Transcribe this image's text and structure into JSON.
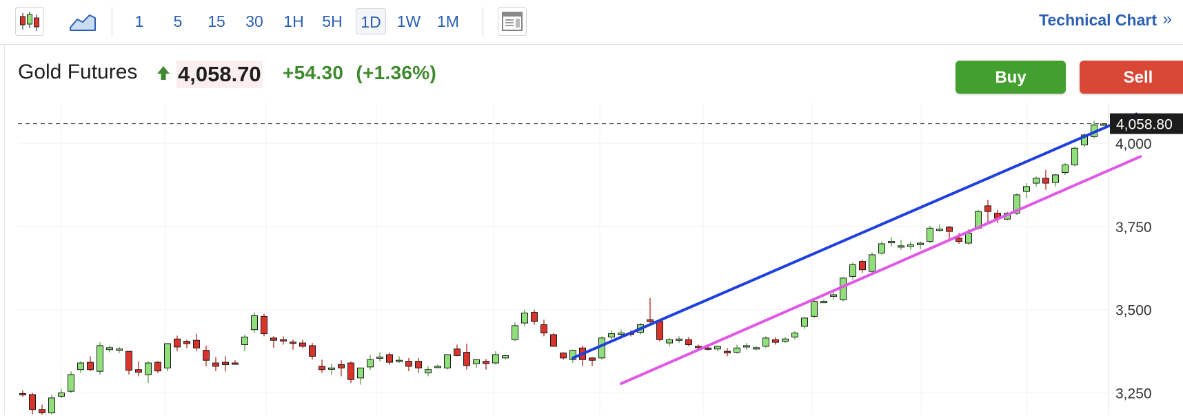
{
  "toolbar": {
    "chart_type_icon": "candlestick-icon",
    "area_icon": "area-chart-icon",
    "layout_icon": "layout-icon",
    "timeframes": [
      {
        "label": "1",
        "active": false
      },
      {
        "label": "5",
        "active": false
      },
      {
        "label": "15",
        "active": false
      },
      {
        "label": "30",
        "active": false
      },
      {
        "label": "1H",
        "active": false
      },
      {
        "label": "5H",
        "active": false
      },
      {
        "label": "1D",
        "active": true
      },
      {
        "label": "1W",
        "active": false
      },
      {
        "label": "1M",
        "active": false
      }
    ],
    "technical_chart_label": "Technical Chart",
    "technical_chart_arrow": "»"
  },
  "header": {
    "instrument": "Gold Futures",
    "price": "4,058.70",
    "change": "+54.30",
    "change_pct": "(+1.36%)",
    "buy_label": "Buy",
    "sell_label": "Sell"
  },
  "colors": {
    "up": "#43a02f",
    "down": "#d94736",
    "link": "#2b5fb3",
    "candle_up_fill": "#8fe07a",
    "candle_down_fill": "#d9342b",
    "upper_channel": "#1f3fe0",
    "lower_channel": "#e058e6"
  },
  "chart_data": {
    "type": "candlestick",
    "y_ticks": [
      "4,000",
      "3,750",
      "3,500",
      "3,250"
    ],
    "y_tick_values": [
      4000,
      3750,
      3500,
      3250
    ],
    "ylim": [
      3185,
      4120
    ],
    "last_price_label": "4,058.80",
    "last_price": 4058.8,
    "grid": true,
    "candles": [
      [
        3248,
        3258,
        3238,
        3245
      ],
      [
        3245,
        3250,
        3180,
        3200
      ],
      [
        3200,
        3215,
        3170,
        3190
      ],
      [
        3190,
        3245,
        3180,
        3235
      ],
      [
        3240,
        3262,
        3235,
        3250
      ],
      [
        3255,
        3315,
        3250,
        3305
      ],
      [
        3320,
        3345,
        3310,
        3340
      ],
      [
        3342,
        3360,
        3315,
        3320
      ],
      [
        3315,
        3402,
        3305,
        3392
      ],
      [
        3380,
        3392,
        3372,
        3386
      ],
      [
        3382,
        3388,
        3370,
        3382
      ],
      [
        3375,
        3375,
        3305,
        3318
      ],
      [
        3320,
        3345,
        3300,
        3312
      ],
      [
        3305,
        3345,
        3280,
        3340
      ],
      [
        3342,
        3345,
        3310,
        3316
      ],
      [
        3325,
        3400,
        3315,
        3398
      ],
      [
        3412,
        3422,
        3375,
        3388
      ],
      [
        3405,
        3410,
        3385,
        3398
      ],
      [
        3408,
        3428,
        3375,
        3385
      ],
      [
        3378,
        3392,
        3330,
        3348
      ],
      [
        3340,
        3358,
        3315,
        3330
      ],
      [
        3342,
        3360,
        3315,
        3335
      ],
      [
        3340,
        3348,
        3335,
        3338
      ],
      [
        3395,
        3425,
        3375,
        3418
      ],
      [
        3440,
        3492,
        3430,
        3482
      ],
      [
        3480,
        3488,
        3420,
        3428
      ],
      [
        3415,
        3420,
        3385,
        3408
      ],
      [
        3410,
        3420,
        3395,
        3408
      ],
      [
        3403,
        3410,
        3380,
        3400
      ],
      [
        3400,
        3410,
        3385,
        3390
      ],
      [
        3392,
        3400,
        3350,
        3360
      ],
      [
        3330,
        3350,
        3310,
        3320
      ],
      [
        3325,
        3338,
        3305,
        3325
      ],
      [
        3335,
        3348,
        3300,
        3325
      ],
      [
        3340,
        3345,
        3280,
        3290
      ],
      [
        3295,
        3325,
        3275,
        3325
      ],
      [
        3328,
        3365,
        3318,
        3350
      ],
      [
        3355,
        3372,
        3345,
        3358
      ],
      [
        3365,
        3372,
        3335,
        3342
      ],
      [
        3345,
        3360,
        3340,
        3348
      ],
      [
        3345,
        3355,
        3315,
        3330
      ],
      [
        3345,
        3355,
        3310,
        3325
      ],
      [
        3310,
        3330,
        3300,
        3320
      ],
      [
        3328,
        3335,
        3325,
        3330
      ],
      [
        3325,
        3365,
        3320,
        3365
      ],
      [
        3382,
        3395,
        3360,
        3362
      ],
      [
        3372,
        3398,
        3320,
        3332
      ],
      [
        3338,
        3352,
        3325,
        3350
      ],
      [
        3345,
        3352,
        3320,
        3338
      ],
      [
        3340,
        3375,
        3335,
        3365
      ],
      [
        3355,
        3365,
        3350,
        3362
      ],
      [
        3410,
        3462,
        3405,
        3452
      ],
      [
        3460,
        3500,
        3450,
        3490
      ],
      [
        3492,
        3500,
        3455,
        3465
      ],
      [
        3455,
        3470,
        3420,
        3430
      ],
      [
        3425,
        3430,
        3390,
        3390
      ],
      [
        3370,
        3372,
        3350,
        3355
      ],
      [
        3350,
        3380,
        3340,
        3378
      ],
      [
        3385,
        3392,
        3330,
        3350
      ],
      [
        3355,
        3358,
        3330,
        3348
      ],
      [
        3355,
        3420,
        3350,
        3415
      ],
      [
        3418,
        3438,
        3412,
        3428
      ],
      [
        3430,
        3440,
        3418,
        3430
      ],
      [
        3430,
        3438,
        3420,
        3428
      ],
      [
        3432,
        3460,
        3425,
        3455
      ],
      [
        3470,
        3535,
        3460,
        3465
      ],
      [
        3465,
        3470,
        3405,
        3410
      ],
      [
        3400,
        3415,
        3390,
        3410
      ],
      [
        3408,
        3420,
        3400,
        3412
      ],
      [
        3410,
        3418,
        3390,
        3395
      ],
      [
        3390,
        3395,
        3380,
        3386
      ],
      [
        3385,
        3392,
        3378,
        3384
      ],
      [
        3382,
        3392,
        3375,
        3390
      ],
      [
        3375,
        3385,
        3360,
        3370
      ],
      [
        3372,
        3395,
        3368,
        3385
      ],
      [
        3390,
        3400,
        3380,
        3392
      ],
      [
        3385,
        3390,
        3378,
        3386
      ],
      [
        3390,
        3420,
        3385,
        3415
      ],
      [
        3410,
        3418,
        3395,
        3402
      ],
      [
        3405,
        3418,
        3400,
        3412
      ],
      [
        3418,
        3435,
        3410,
        3430
      ],
      [
        3450,
        3478,
        3442,
        3475
      ],
      [
        3480,
        3535,
        3475,
        3525
      ],
      [
        3522,
        3530,
        3520,
        3525
      ],
      [
        3540,
        3552,
        3530,
        3545
      ],
      [
        3530,
        3598,
        3525,
        3595
      ],
      [
        3600,
        3642,
        3590,
        3635
      ],
      [
        3645,
        3650,
        3610,
        3620
      ],
      [
        3615,
        3672,
        3610,
        3665
      ],
      [
        3670,
        3705,
        3665,
        3698
      ],
      [
        3703,
        3718,
        3690,
        3705
      ],
      [
        3688,
        3710,
        3680,
        3692
      ],
      [
        3690,
        3705,
        3680,
        3695
      ],
      [
        3695,
        3705,
        3682,
        3700
      ],
      [
        3705,
        3752,
        3700,
        3745
      ],
      [
        3740,
        3756,
        3735,
        3742
      ],
      [
        3748,
        3752,
        3705,
        3735
      ],
      [
        3715,
        3730,
        3698,
        3705
      ],
      [
        3700,
        3742,
        3695,
        3730
      ],
      [
        3745,
        3800,
        3740,
        3795
      ],
      [
        3812,
        3830,
        3760,
        3795
      ],
      [
        3790,
        3800,
        3760,
        3775
      ],
      [
        3772,
        3795,
        3768,
        3790
      ],
      [
        3790,
        3850,
        3785,
        3845
      ],
      [
        3855,
        3880,
        3835,
        3870
      ],
      [
        3880,
        3900,
        3870,
        3895
      ],
      [
        3895,
        3920,
        3860,
        3880
      ],
      [
        3882,
        3908,
        3870,
        3905
      ],
      [
        3912,
        3940,
        3905,
        3935
      ],
      [
        3935,
        3990,
        3930,
        3985
      ],
      [
        3995,
        4030,
        3990,
        4025
      ],
      [
        4020,
        4068,
        4015,
        4055
      ],
      [
        4055,
        4058,
        4052,
        4058
      ]
    ],
    "trendlines": [
      {
        "name": "upper",
        "from": [
          1,
          3355
        ],
        "to": [
          1,
          4088
        ],
        "color": "#1f3fe0"
      },
      {
        "name": "lower",
        "from": [
          1,
          3278
        ],
        "to": [
          1,
          3960
        ],
        "color": "#e058e6"
      }
    ]
  }
}
